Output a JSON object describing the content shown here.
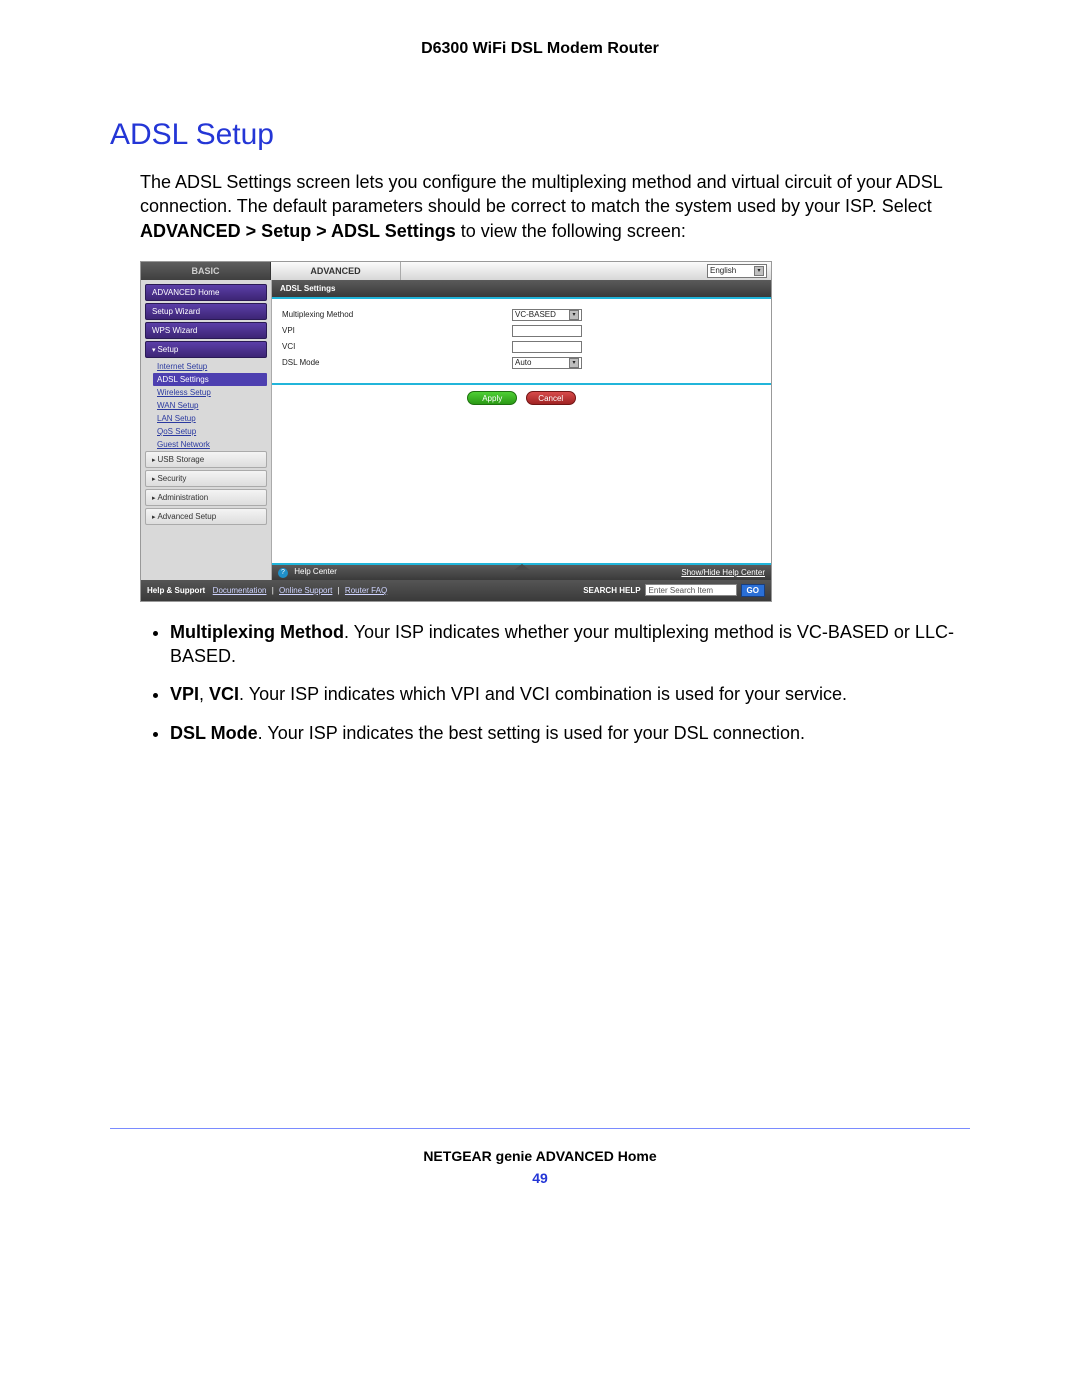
{
  "doc": {
    "header": "D6300 WiFi DSL Modem Router",
    "section_title": "ADSL Setup",
    "intro_pre": "The ADSL Settings screen lets you configure the multiplexing method and virtual circuit of your ADSL connection. The default parameters should be correct to match the system used by your ISP. Select ",
    "intro_bold": "ADVANCED > Setup > ADSL Settings",
    "intro_post": " to view the following screen:",
    "bullets": [
      {
        "bold": "Multiplexing Method",
        "text": ". Your ISP indicates whether your multiplexing method is VC-BASED or LLC-BASED."
      },
      {
        "bold": "VPI",
        "mid": ", ",
        "bold2": "VCI",
        "text": ". Your ISP indicates which VPI and VCI combination is used for your service."
      },
      {
        "bold": "DSL Mode",
        "text": ". Your ISP indicates the best setting is used for your DSL connection."
      }
    ],
    "footer_title": "NETGEAR genie ADVANCED Home",
    "page_number": "49"
  },
  "ui": {
    "tabs": {
      "basic": "BASIC",
      "advanced": "ADVANCED"
    },
    "language": "English",
    "sidebar": {
      "home": "ADVANCED Home",
      "setup_wizard": "Setup Wizard",
      "wps_wizard": "WPS Wizard",
      "setup": "Setup",
      "setup_children": [
        "Internet Setup",
        "ADSL Settings",
        "Wireless Setup",
        "WAN Setup",
        "LAN Setup",
        "QoS Setup",
        "Guest Network"
      ],
      "sections": [
        "USB Storage",
        "Security",
        "Administration",
        "Advanced Setup"
      ]
    },
    "panel": {
      "title": "ADSL Settings",
      "rows": {
        "multiplexing_label": "Multiplexing Method",
        "multiplexing_value": "VC-BASED",
        "vpi_label": "VPI",
        "vci_label": "VCI",
        "dsl_mode_label": "DSL Mode",
        "dsl_mode_value": "Auto"
      },
      "apply": "Apply",
      "cancel": "Cancel"
    },
    "help_bar": {
      "label": "Help Center",
      "toggle": "Show/Hide Help Center"
    },
    "footer": {
      "left_label": "Help & Support",
      "links": [
        "Documentation",
        "Online Support",
        "Router FAQ"
      ],
      "search_label": "SEARCH HELP",
      "search_placeholder": "Enter Search Item",
      "go": "GO"
    }
  }
}
